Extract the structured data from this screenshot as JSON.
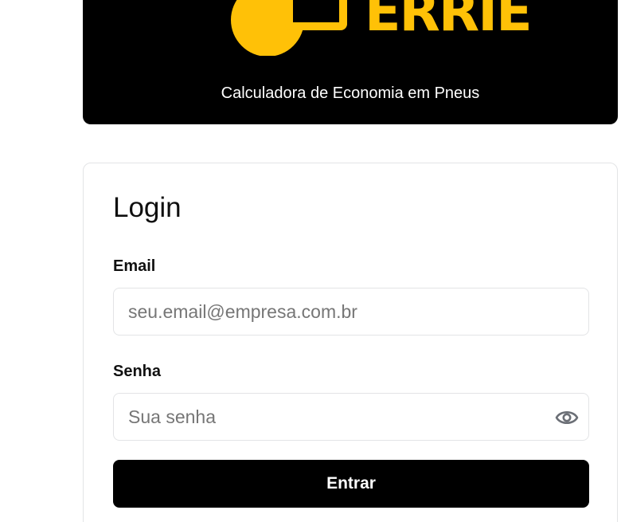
{
  "brand": {
    "logo_text": "ERRIE",
    "subtitle": "Calculadora de Economia em Pneus",
    "accent_color": "#FFC107",
    "background_color": "#000000"
  },
  "login": {
    "title": "Login",
    "email_label": "Email",
    "email_placeholder": "seu.email@empresa.com.br",
    "email_value": "",
    "password_label": "Senha",
    "password_placeholder": "Sua senha",
    "password_value": "",
    "show_password_icon": "eye-icon",
    "submit_label": "Entrar"
  }
}
